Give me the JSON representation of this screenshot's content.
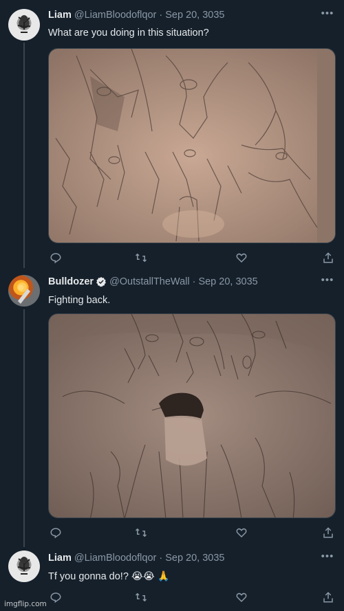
{
  "colors": {
    "background": "#15202b",
    "muted": "#8b98a5",
    "text": "#e7e9ea",
    "verified": "#e7e9ea"
  },
  "tweets": [
    {
      "name": "Liam",
      "handle": "@LiamBloodoflqor",
      "sep": "·",
      "date": "Sep 20, 3035",
      "text": "What are you doing in this situation?",
      "media_icon": "pencil-drawing-three-figures-photo"
    },
    {
      "name": "Bulldozer",
      "handle": "@OutstallTheWall",
      "sep": "·",
      "date": "Sep 20, 3035",
      "text": "Fighting back.",
      "media_icon": "pencil-drawing-figure-facing-fire-photo"
    },
    {
      "name": "Liam",
      "handle": "@LiamBloodoflqor",
      "sep": "·",
      "date": "Sep 20, 3035",
      "text": "Tf you gonna do!? 😭😭 🙏"
    }
  ],
  "watermark": "imgflip.com"
}
